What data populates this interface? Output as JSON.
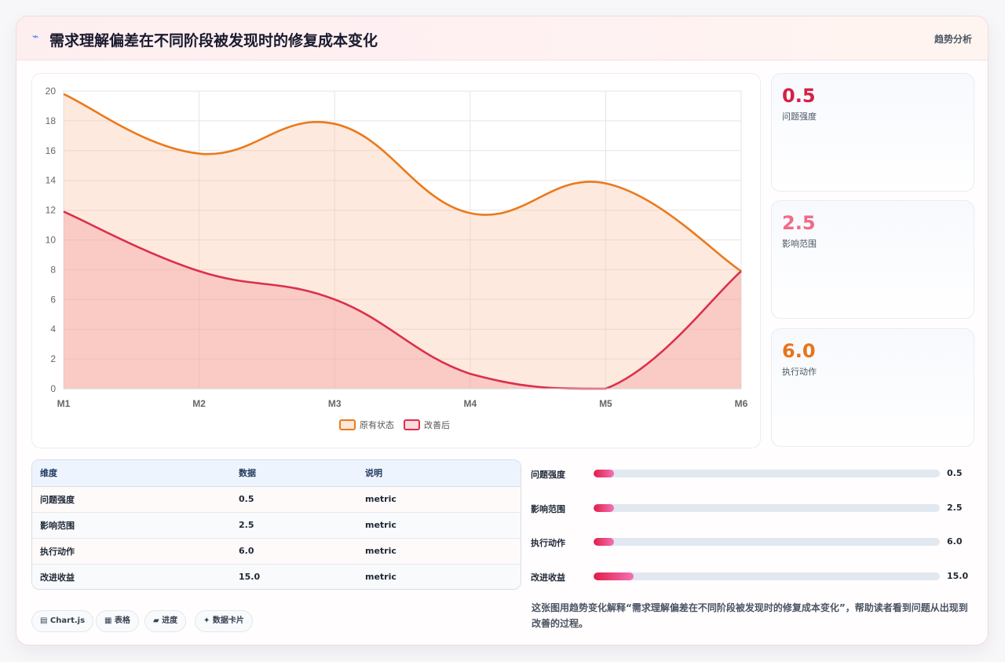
{
  "header": {
    "icon": "lightning-icon",
    "title": "需求理解偏差在不同阶段被发现时的修复成本变化",
    "tag": "趋势分析"
  },
  "chart_data": {
    "type": "area",
    "categories": [
      "M1",
      "M2",
      "M3",
      "M4",
      "M5",
      "M6"
    ],
    "series": [
      {
        "name": "原有状态",
        "values": [
          19.8,
          15.8,
          17.8,
          11.8,
          13.8,
          7.9
        ],
        "color": "#ea7a1c"
      },
      {
        "name": "改善后",
        "values": [
          11.9,
          7.9,
          6.0,
          1.0,
          0.0,
          7.9
        ],
        "color": "#dc2f4a"
      }
    ],
    "ylim": [
      0,
      20
    ],
    "yticks": [
      0,
      2,
      4,
      6,
      8,
      10,
      12,
      14,
      16,
      18,
      20
    ],
    "grid": true,
    "legend": "bottom",
    "xlabel": "",
    "ylabel": ""
  },
  "stats": [
    {
      "value": "0.5",
      "label": "问题强度",
      "color": "#d61f45"
    },
    {
      "value": "2.5",
      "label": "影响范围",
      "color": "#f06b86"
    },
    {
      "value": "6.0",
      "label": "执行动作",
      "color": "#e8741a"
    }
  ],
  "table": {
    "headers": [
      "维度",
      "数据",
      "说明"
    ],
    "rows": [
      [
        "问题强度",
        "0.5",
        "metric"
      ],
      [
        "影响范围",
        "2.5",
        "metric"
      ],
      [
        "执行动作",
        "6.0",
        "metric"
      ],
      [
        "改进收益",
        "15.0",
        "metric"
      ]
    ]
  },
  "progress": [
    {
      "label": "问题强度",
      "value": "0.5",
      "fraction": 0.06
    },
    {
      "label": "影响范围",
      "value": "2.5",
      "fraction": 0.06
    },
    {
      "label": "执行动作",
      "value": "6.0",
      "fraction": 0.06
    },
    {
      "label": "改进收益",
      "value": "15.0",
      "fraction": 0.115
    }
  ],
  "chips": [
    "▤ Chart.js",
    "▦ 表格",
    "▰ 进度",
    "✦ 数据卡片"
  ],
  "note": "这张图用趋势变化解释“需求理解偏差在不同阶段被发现时的修复成本变化”，帮助读者看到问题从出现到改善的过程。"
}
